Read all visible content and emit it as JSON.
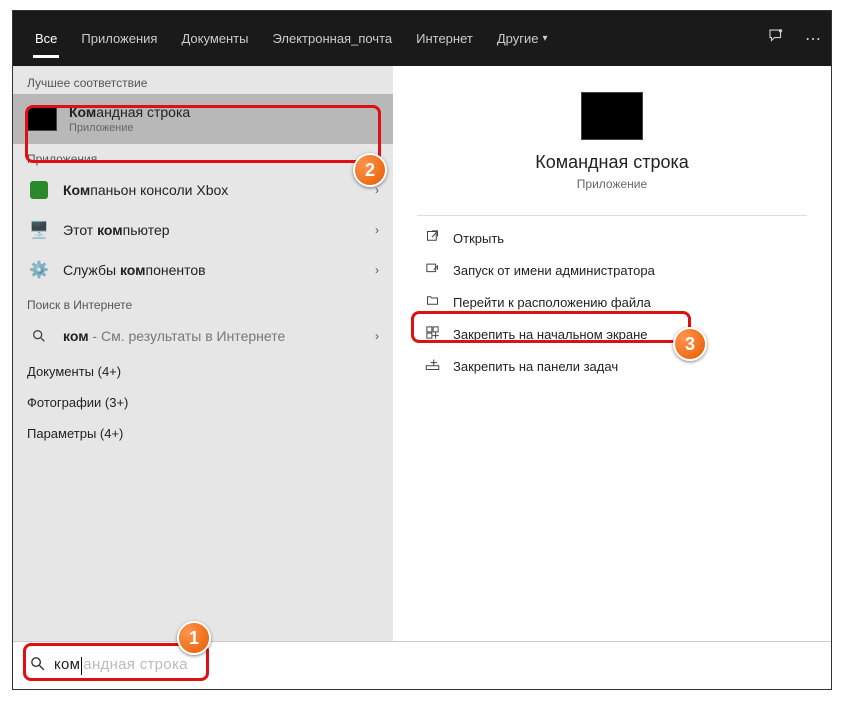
{
  "tabs": {
    "all": "Все",
    "apps": "Приложения",
    "docs": "Документы",
    "email": "Электронная_почта",
    "internet": "Интернет",
    "other": "Другие"
  },
  "sections": {
    "best_match": "Лучшее соответствие",
    "apps": "Приложения",
    "web": "Поиск в Интернете"
  },
  "best": {
    "title_pre": "Ком",
    "title_rest": "андная строка",
    "sub": "Приложение"
  },
  "app_results": [
    {
      "pre": "Ком",
      "rest": "паньон консоли Xbox"
    },
    {
      "pre_a": "Этот ",
      "pre": "ком",
      "rest": "пьютер"
    },
    {
      "pre_a": "Службы ",
      "pre": "ком",
      "rest": "понентов"
    }
  ],
  "web_result": {
    "pre": "ком",
    "rest": " - См. результаты в Интернете"
  },
  "more_rows": {
    "docs": "Документы (4+)",
    "photos": "Фотографии (3+)",
    "params": "Параметры (4+)"
  },
  "preview": {
    "title": "Командная строка",
    "sub": "Приложение"
  },
  "actions": {
    "open": "Открыть",
    "run_admin": "Запуск от имени администратора",
    "goto_file": "Перейти к расположению файла",
    "pin_start": "Закрепить на начальном экране",
    "pin_taskbar": "Закрепить на панели задач"
  },
  "search": {
    "typed": "ком",
    "ghost": "андная строка"
  },
  "badges": {
    "b1": "1",
    "b2": "2",
    "b3": "3"
  }
}
